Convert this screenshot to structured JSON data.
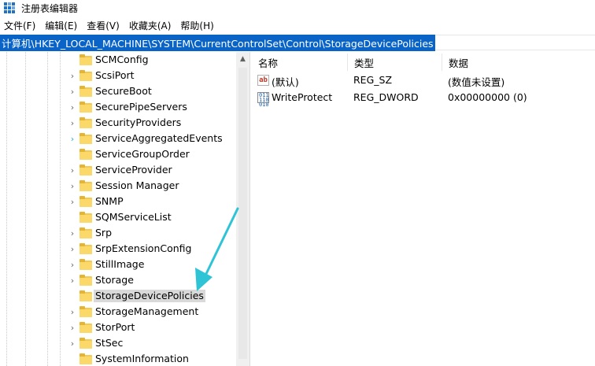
{
  "window": {
    "title": "注册表编辑器"
  },
  "menu": [
    "文件(F)",
    "编辑(E)",
    "查看(V)",
    "收藏夹(A)",
    "帮助(H)"
  ],
  "address": {
    "path": "计算机\\HKEY_LOCAL_MACHINE\\SYSTEM\\CurrentControlSet\\Control\\StorageDevicePolicies"
  },
  "tree": {
    "items": [
      {
        "label": "SCMConfig",
        "expandable": false
      },
      {
        "label": "ScsiPort",
        "expandable": true
      },
      {
        "label": "SecureBoot",
        "expandable": true
      },
      {
        "label": "SecurePipeServers",
        "expandable": true
      },
      {
        "label": "SecurityProviders",
        "expandable": true
      },
      {
        "label": "ServiceAggregatedEvents",
        "expandable": true,
        "hover": true
      },
      {
        "label": "ServiceGroupOrder",
        "expandable": false
      },
      {
        "label": "ServiceProvider",
        "expandable": true
      },
      {
        "label": "Session Manager",
        "expandable": true
      },
      {
        "label": "SNMP",
        "expandable": true
      },
      {
        "label": "SQMServiceList",
        "expandable": false
      },
      {
        "label": "Srp",
        "expandable": true
      },
      {
        "label": "SrpExtensionConfig",
        "expandable": true
      },
      {
        "label": "StillImage",
        "expandable": true
      },
      {
        "label": "Storage",
        "expandable": true
      },
      {
        "label": "StorageDevicePolicies",
        "expandable": false,
        "selected": true
      },
      {
        "label": "StorageManagement",
        "expandable": true
      },
      {
        "label": "StorPort",
        "expandable": true
      },
      {
        "label": "StSec",
        "expandable": true
      },
      {
        "label": "SystemInformation",
        "expandable": false
      }
    ]
  },
  "values": {
    "columns": [
      "名称",
      "类型",
      "数据"
    ],
    "rows": [
      {
        "icon": "string-value-icon",
        "name": "(默认)",
        "type": "REG_SZ",
        "data": "(数值未设置)"
      },
      {
        "icon": "dword-value-icon",
        "name": "WriteProtect",
        "type": "REG_DWORD",
        "data": "0x00000000 (0)"
      }
    ]
  },
  "colors": {
    "selection": "#0a64c8",
    "annotation_arrow": "#2ec4d6",
    "folder": "#f4c94f"
  }
}
